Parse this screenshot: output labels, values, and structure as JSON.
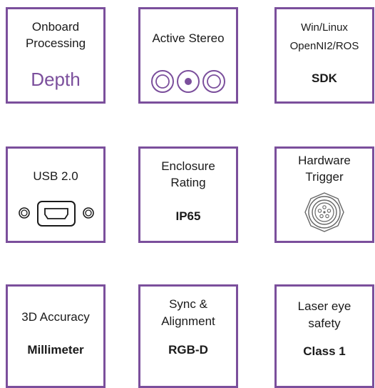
{
  "cards": {
    "processing": {
      "line1": "Onboard",
      "line2": "Processing",
      "value": "Depth"
    },
    "stereo": {
      "title": "Active Stereo"
    },
    "sdk": {
      "line1": "Win/Linux",
      "line2": "OpenNI2/ROS",
      "value": "SDK"
    },
    "usb": {
      "title": "USB 2.0"
    },
    "enclosure": {
      "line1": "Enclosure",
      "line2": "Rating",
      "value": "IP65"
    },
    "trigger": {
      "line1": "Hardware",
      "line2": "Trigger"
    },
    "accuracy": {
      "title": "3D Accuracy",
      "value": "Millimeter"
    },
    "sync": {
      "line1": "Sync &",
      "line2": "Alignment",
      "value": "RGB-D"
    },
    "laser": {
      "line1": "Laser eye",
      "line2": "safety",
      "value": "Class 1"
    }
  },
  "colors": {
    "border": "#7b4f9c",
    "accent": "#7b4f9c",
    "text": "#1a1a1a"
  }
}
